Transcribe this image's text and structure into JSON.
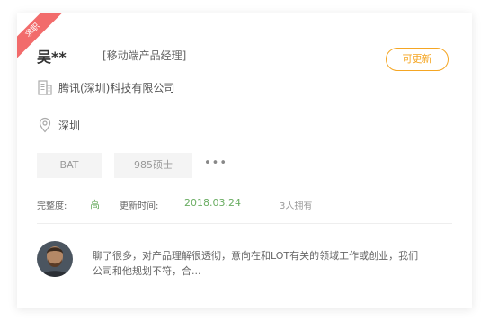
{
  "candidate": {
    "ribbon_label": "求职",
    "name": "吴**",
    "position": "[移动端产品经理]",
    "update_label": "可更新",
    "company": "腾讯(深圳)科技有限公司",
    "city": "深圳",
    "tags": [
      "BAT",
      "985硕士"
    ],
    "more": "•••"
  },
  "meta": {
    "completeness_label": "完整度:",
    "completeness_value": "高",
    "updated_label": "更新时间:",
    "updated_value": "2018.03.24",
    "owners": "3人拥有"
  },
  "note": {
    "text": "聊了很多，对产品理解很透彻，意向在和LOT有关的领域工作或创业，我们公司和他规划不符，合..."
  },
  "colors": {
    "ribbon": "#f26b6b",
    "accent_orange": "#f5a623",
    "accent_green": "#6aad62"
  },
  "icons": {
    "company": "building-icon",
    "city": "location-pin-icon",
    "avatar": "person-avatar"
  }
}
